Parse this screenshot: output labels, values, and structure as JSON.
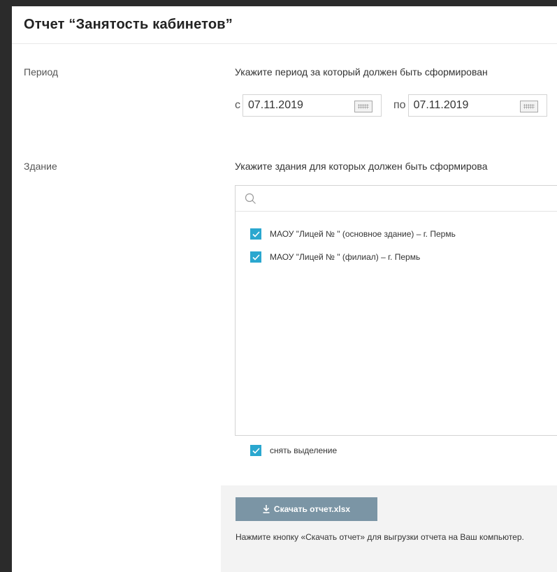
{
  "title": "Отчет “Занятость кабинетов”",
  "period": {
    "label": "Период",
    "hint": "Укажите период за который должен быть сформирован",
    "from_prefix": "с",
    "from_value": "07.11.2019",
    "to_prefix": "по",
    "to_value": "07.11.2019",
    "calendar_icon": "calendar-icon"
  },
  "building": {
    "label": "Здание",
    "hint": "Укажите здания для которых должен быть сформирова",
    "search_placeholder": "",
    "items": [
      {
        "label": "МАОУ \"Лицей № \" (основное здание) – г. Пермь",
        "checked": true
      },
      {
        "label": "МАОУ \"Лицей № \" (филиал) – г. Пермь",
        "checked": true
      }
    ],
    "deselect_label": "снять выделение",
    "deselect_checked": true
  },
  "download": {
    "button_label": "Скачать отчет.xlsx",
    "icon": "download-icon",
    "note": "Нажмите кнопку «Скачать отчет» для выгрузки отчета на Ваш компьютер."
  },
  "colors": {
    "checkbox": "#2aa7cf",
    "button": "#7b95a5",
    "panel": "#f3f3f3"
  }
}
